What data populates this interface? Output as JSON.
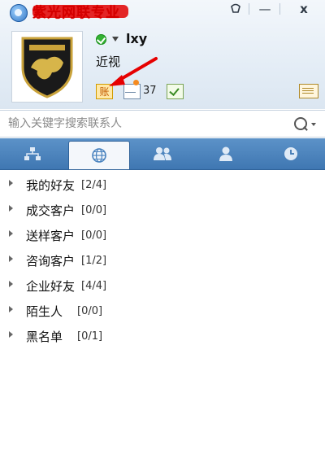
{
  "window": {
    "title": "紫光网联专业",
    "minimize_label": "—",
    "close_label": "x"
  },
  "profile": {
    "username": "lxy",
    "signature": "近视",
    "avatar_icon": "lamborghini-logo",
    "status_icon": "online-check-icon"
  },
  "toolbar": {
    "account_label": "账",
    "mail_count": "37"
  },
  "search": {
    "placeholder": "输入关键字搜索联系人"
  },
  "tabs": [
    {
      "icon": "org-chart-icon"
    },
    {
      "icon": "globe-icon"
    },
    {
      "icon": "group-icon"
    },
    {
      "icon": "person-icon"
    },
    {
      "icon": "clock-icon"
    }
  ],
  "groups": [
    {
      "name": "我的好友",
      "count": "[2/4]"
    },
    {
      "name": "成交客户",
      "count": "[0/0]"
    },
    {
      "name": "送样客户",
      "count": "[0/0]"
    },
    {
      "name": "咨询客户",
      "count": "[1/2]"
    },
    {
      "name": "企业好友",
      "count": "[4/4]"
    },
    {
      "name": "陌生人",
      "count": "[0/0]"
    },
    {
      "name": "黑名单",
      "count": "[0/1]"
    }
  ],
  "colors": {
    "tab_bar": "#4a83bf",
    "annotation_arrow": "#e60000",
    "title_scribble": "#e10000"
  }
}
